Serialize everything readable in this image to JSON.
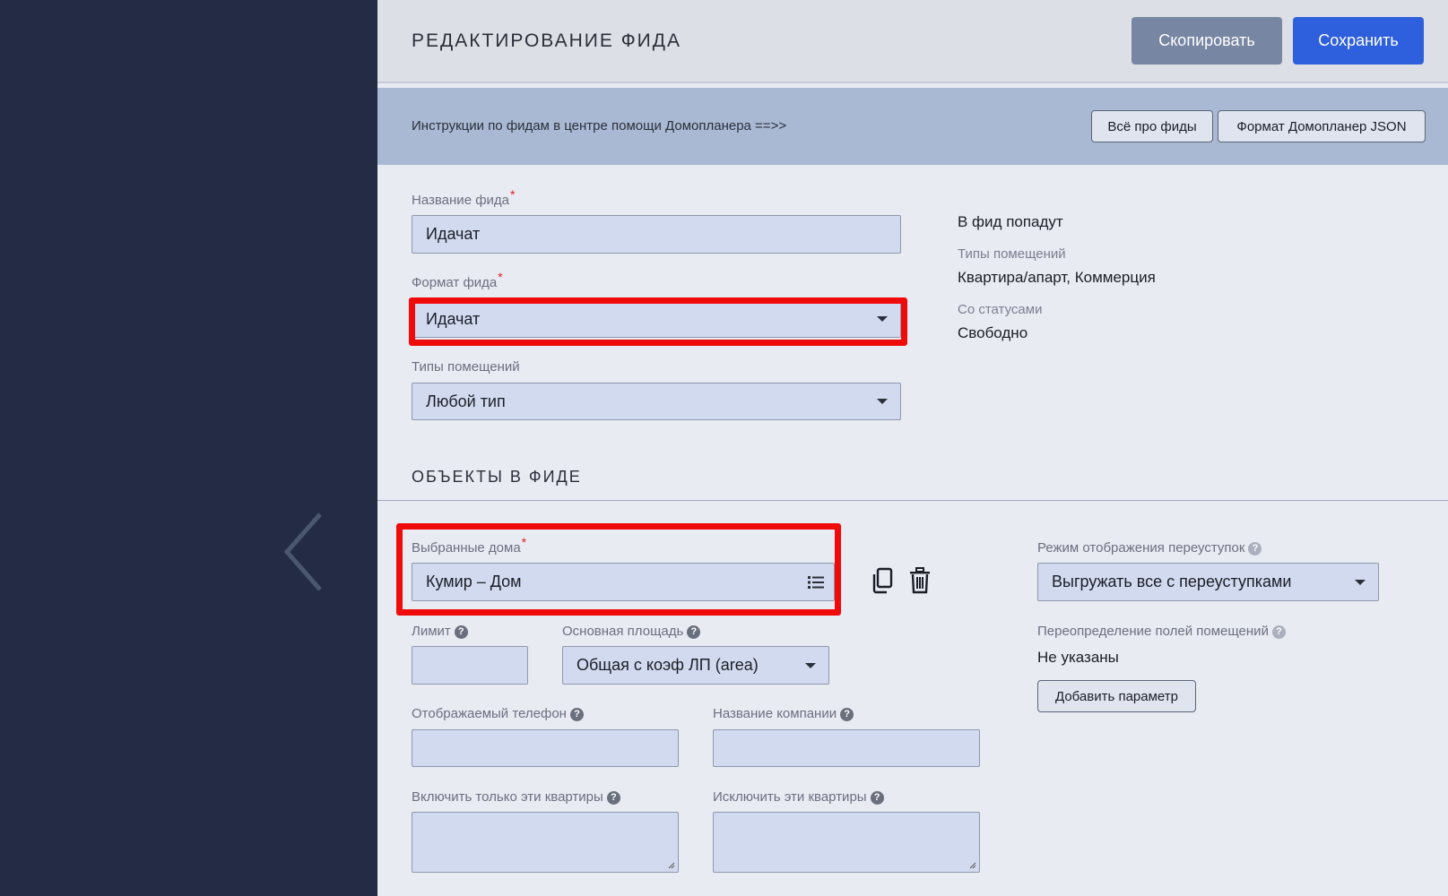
{
  "header": {
    "title": "РЕДАКТИРОВАНИЕ ФИДА",
    "copy_label": "Скопировать",
    "save_label": "Сохранить"
  },
  "info_bar": {
    "text": "Инструкции по фидам в центре помощи Домопланера ==>>",
    "link_all_feeds": "Всё про фиды",
    "link_json_format": "Формат Домопланер JSON"
  },
  "form": {
    "feed_name": {
      "label": "Название фида",
      "value": "Идачат"
    },
    "feed_format": {
      "label": "Формат фида",
      "value": "Идачат"
    },
    "room_types": {
      "label": "Типы помещений",
      "value": "Любой тип"
    }
  },
  "summary": {
    "title": "В фид попадут",
    "types_label": "Типы помещений",
    "types_value": "Квартира/апарт, Коммерция",
    "status_label": "Со статусами",
    "status_value": "Свободно"
  },
  "objects": {
    "section_title": "ОБЪЕКТЫ В ФИДЕ",
    "houses": {
      "label": "Выбранные дома",
      "value": "Кумир – Дом"
    },
    "limit": {
      "label": "Лимит",
      "value": ""
    },
    "main_area": {
      "label": "Основная площадь",
      "value": "Общая с коэф ЛП (area)"
    },
    "phone": {
      "label": "Отображаемый телефон",
      "value": ""
    },
    "company": {
      "label": "Название компании",
      "value": ""
    },
    "include_flats": {
      "label": "Включить только эти квартиры",
      "value": ""
    },
    "exclude_flats": {
      "label": "Исключить эти квартиры",
      "value": ""
    },
    "reassign_mode": {
      "label": "Режим отображения переуступок",
      "value": "Выгружать все с переуступками"
    },
    "override_fields": {
      "label": "Переопределение полей помещений",
      "value": "Не указаны",
      "add_label": "Добавить параметр"
    }
  },
  "colors": {
    "sidebar": "#232c44",
    "primary": "#2e5fdc",
    "secondary": "#7786a3",
    "highlight": "#f00b0b",
    "input_bg": "#d2daef"
  },
  "icons": [
    "back-arrow-icon",
    "list-icon",
    "copy-icon",
    "trash-icon",
    "question-icon",
    "caret-down-icon"
  ]
}
